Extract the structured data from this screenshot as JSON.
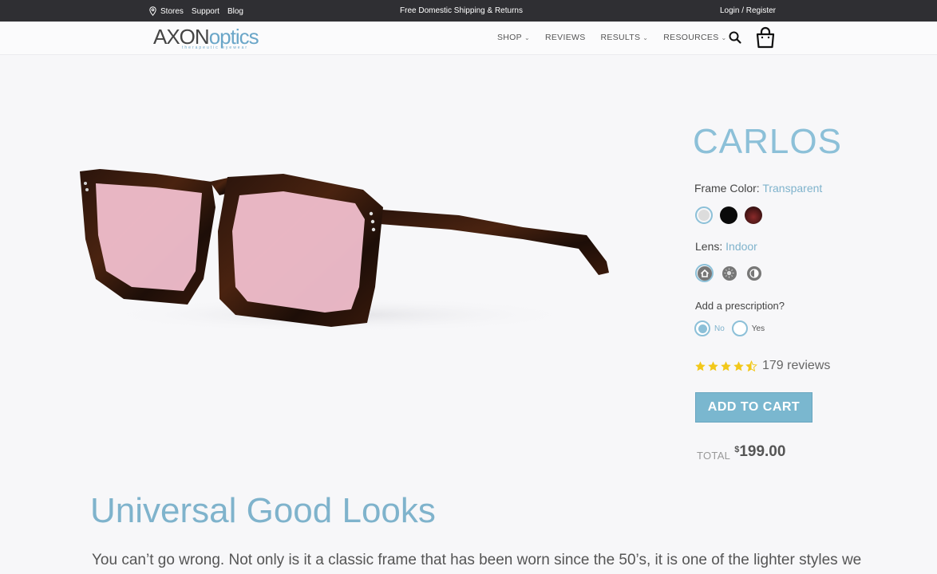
{
  "topbar": {
    "stores": "Stores",
    "support": "Support",
    "blog": "Blog",
    "promo": "Free Domestic Shipping & Returns",
    "login": "Login / Register"
  },
  "header": {
    "logo_main_a": "AXON",
    "logo_main_b": "optics",
    "logo_tagline": "therapeutic eyewear",
    "nav": [
      {
        "label": "SHOP",
        "has_dropdown": true
      },
      {
        "label": "REVIEWS",
        "has_dropdown": false
      },
      {
        "label": "RESULTS",
        "has_dropdown": true
      },
      {
        "label": "RESOURCES",
        "has_dropdown": true
      }
    ],
    "icons": [
      "search-icon",
      "shopping-bag-icon"
    ]
  },
  "product": {
    "name": "CARLOS",
    "frame_color_label": "Frame Color:",
    "frame_color_value": "Transparent",
    "frame_swatches": [
      {
        "name": "Transparent",
        "color": "#dcdcdc",
        "selected": true
      },
      {
        "name": "Black",
        "color": "#0a0a0a",
        "selected": false
      },
      {
        "name": "Tortoise Red",
        "color": "#5a1c1c",
        "selected": false
      }
    ],
    "lens_label": "Lens:",
    "lens_value": "Indoor",
    "lens_options": [
      {
        "name": "Indoor",
        "icon": "home-icon",
        "selected": true
      },
      {
        "name": "Outdoor",
        "icon": "sun-icon",
        "selected": false
      },
      {
        "name": "Contrast",
        "icon": "half-circle-icon",
        "selected": false
      }
    ],
    "prescription_label": "Add a prescription?",
    "prescription_options": [
      {
        "label": "No",
        "selected": true
      },
      {
        "label": "Yes",
        "selected": false
      }
    ],
    "rating": 4.5,
    "reviews_text": "179 reviews",
    "add_to_cart": "ADD TO CART",
    "total_label": "TOTAL",
    "currency": "$",
    "price": "199.00",
    "lens_tint": "#f1bfcd",
    "accent": "#7ab7cf"
  },
  "content": {
    "headline": "Universal Good Looks",
    "description": "You can’t go wrong. Not only is it a classic frame that has been worn since the 50’s, it is one of the lighter styles we"
  }
}
